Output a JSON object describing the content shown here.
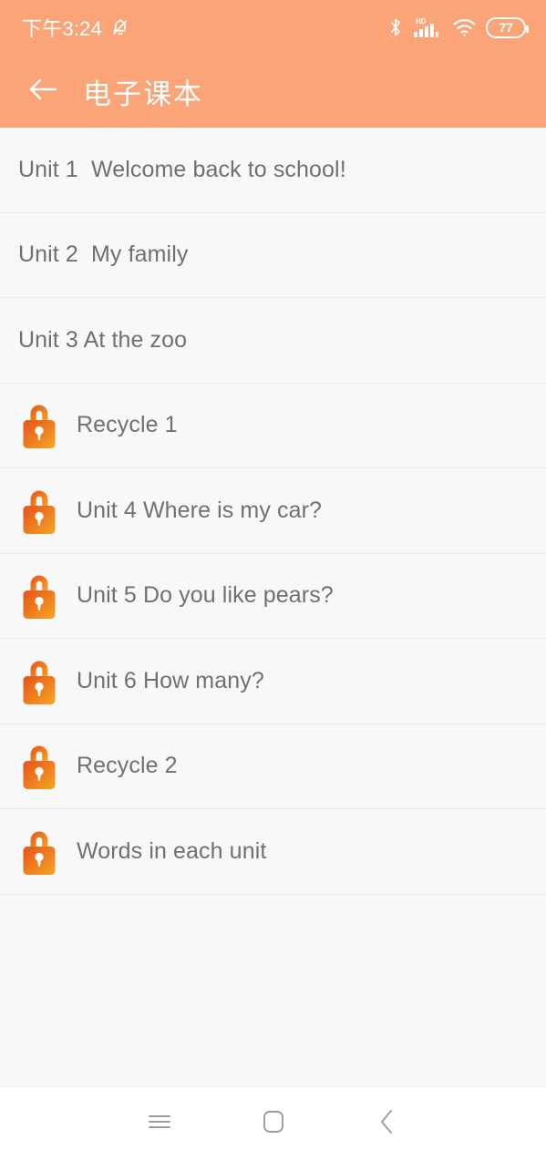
{
  "status_bar": {
    "time": "下午3:24",
    "icons": {
      "mute": "bell-muted-icon",
      "bluetooth": "bluetooth-icon",
      "hd": "hd-label-icon",
      "signal": "cellular-signal-icon",
      "wifi": "wifi-icon",
      "battery": "battery-icon"
    },
    "battery_level": "77"
  },
  "app_bar": {
    "back": "back-arrow-icon",
    "title": "电子课本"
  },
  "list": {
    "items": [
      {
        "label": "Unit 1  Welcome back to school!",
        "locked": false
      },
      {
        "label": "Unit 2  My family",
        "locked": false
      },
      {
        "label": "Unit 3 At the zoo",
        "locked": false
      },
      {
        "label": "Recycle 1",
        "locked": true
      },
      {
        "label": "Unit 4 Where is my car?",
        "locked": true
      },
      {
        "label": "Unit 5 Do you like pears?",
        "locked": true
      },
      {
        "label": "Unit 6 How many?",
        "locked": true
      },
      {
        "label": "Recycle 2",
        "locked": true
      },
      {
        "label": "Words in each unit",
        "locked": true
      }
    ]
  },
  "nav_bar": {
    "recents": "menu-icon",
    "home": "home-square-icon",
    "back": "chevron-left-icon"
  },
  "colors": {
    "header": "#FAA477",
    "background": "#F8F8F9",
    "text": "#6E7074",
    "divider": "#EAEAEB",
    "lock_start": "#E8521A",
    "lock_end": "#F5A623"
  }
}
